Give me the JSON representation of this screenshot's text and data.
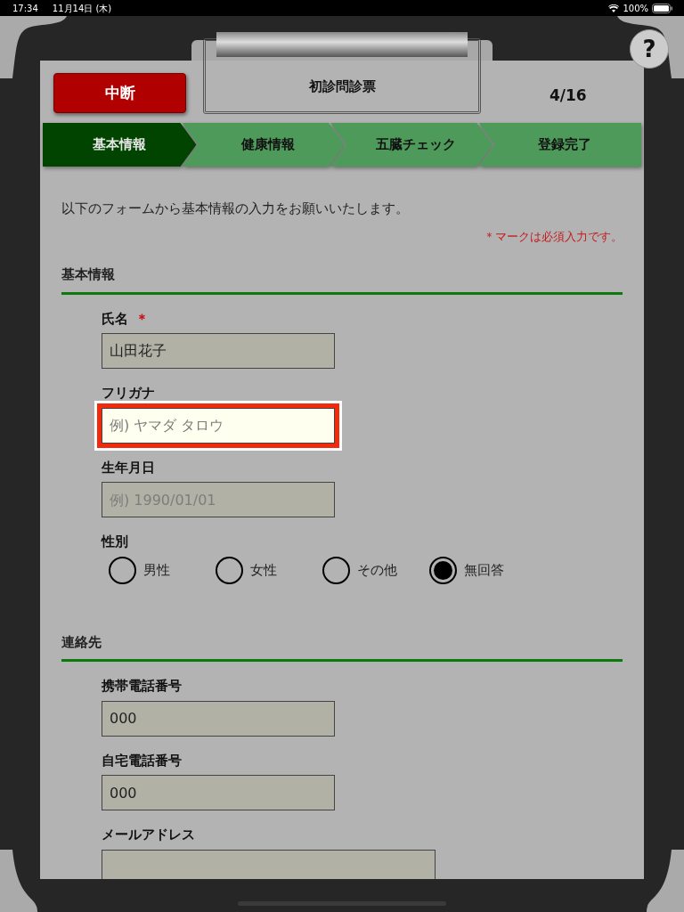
{
  "status_bar": {
    "time": "17:34",
    "date": "11月14日 (木)",
    "battery": "100%"
  },
  "header": {
    "stop_button": "中断",
    "title": "初診問診票",
    "page_count": "4/16",
    "help_button": "?"
  },
  "steps": [
    {
      "label": "基本情報",
      "selected": true
    },
    {
      "label": "健康情報",
      "selected": false
    },
    {
      "label": "五臓チェック",
      "selected": false
    },
    {
      "label": "登録完了",
      "selected": false
    }
  ],
  "intro": "以下のフォームから基本情報の入力をお願いいたします。",
  "required_note": {
    "mark": "＊",
    "text": "マークは必須入力です。"
  },
  "sections": [
    {
      "heading": "基本情報",
      "fields": [
        {
          "kind": "text",
          "label": "氏名",
          "required_mark": "＊",
          "value": "山田花子",
          "focused": false
        },
        {
          "kind": "text",
          "label": "フリガナ",
          "placeholder": "例) ヤマダ タロウ",
          "focused": true
        },
        {
          "kind": "text",
          "label": "生年月日",
          "placeholder": "例) 1990/01/01",
          "focused": false
        },
        {
          "kind": "radio",
          "label": "性別",
          "options": [
            {
              "label": "男性",
              "selected": false
            },
            {
              "label": "女性",
              "selected": false
            },
            {
              "label": "その他",
              "selected": false
            },
            {
              "label": "無回答",
              "selected": true
            }
          ]
        }
      ]
    },
    {
      "heading": "連絡先",
      "fields": [
        {
          "kind": "text",
          "label": "携帯電話番号",
          "value": "000",
          "focused": false
        },
        {
          "kind": "text",
          "label": "自宅電話番号",
          "value": "000",
          "focused": false
        },
        {
          "kind": "email",
          "label": "メールアドレス",
          "focused": false
        }
      ]
    }
  ]
}
